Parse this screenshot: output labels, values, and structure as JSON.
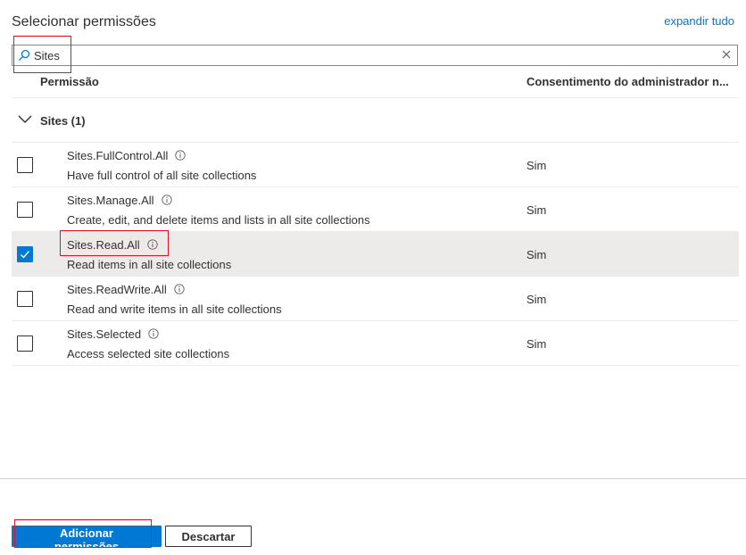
{
  "header": {
    "title": "Selecionar permissões",
    "expand_all": "expandir tudo"
  },
  "search": {
    "value": "Sites",
    "icon": "search-icon",
    "clear_icon": "close-icon"
  },
  "columns": {
    "permission": "Permissão",
    "admin_consent": "Consentimento do administrador n..."
  },
  "group": {
    "label": "Sites (1)",
    "expanded": true
  },
  "permissions": [
    {
      "name": "Sites.FullControl.All",
      "description": "Have full control of all site collections",
      "consent": "Sim",
      "checked": false
    },
    {
      "name": "Sites.Manage.All",
      "description": "Create, edit, and delete items and lists in all site collections",
      "consent": "Sim",
      "checked": false
    },
    {
      "name": "Sites.Read.All",
      "description": "Read items in all site collections",
      "consent": "Sim",
      "checked": true
    },
    {
      "name": "Sites.ReadWrite.All",
      "description": "Read and write items in all site collections",
      "consent": "Sim",
      "checked": false
    },
    {
      "name": "Sites.Selected",
      "description": "Access selected site collections",
      "consent": "Sim",
      "checked": false
    }
  ],
  "footer": {
    "add_label": "Adicionar permissões",
    "discard_label": "Descartar"
  },
  "colors": {
    "accent": "#0078d4",
    "highlight": "#e81123",
    "selected_row": "#edebe9"
  }
}
